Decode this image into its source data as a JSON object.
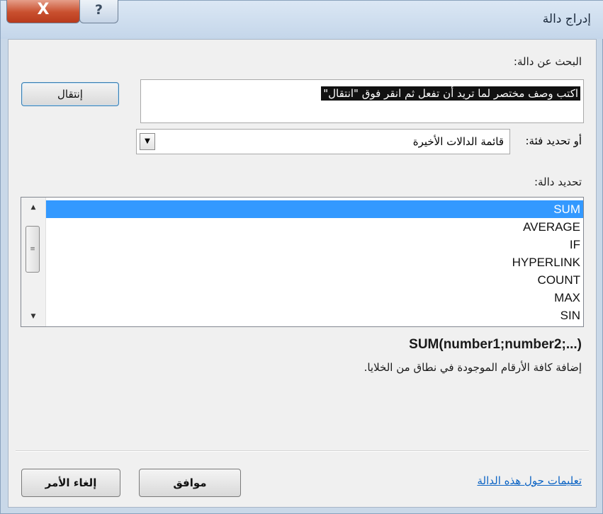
{
  "window": {
    "title": "إدراج دالة",
    "close_glyph": "X",
    "help_glyph": "?"
  },
  "search": {
    "label": "البحث عن دالة:",
    "text": "اكتب وصف مختصر لما تريد أن تفعل ثم انقر فوق \"انتقال\"",
    "go_label": "إنتقال"
  },
  "category": {
    "label": "أو تحديد فئة:",
    "selected": "قائمة الدالات الأخيرة"
  },
  "function_list": {
    "label": "تحديد دالة:",
    "items": [
      "SUM",
      "AVERAGE",
      "IF",
      "HYPERLINK",
      "COUNT",
      "MAX",
      "SIN"
    ],
    "selected": "SUM"
  },
  "details": {
    "syntax": "SUM(number1;number2;...)",
    "description": "إضافة كافة الأرقام الموجودة في نطاق من الخلايا."
  },
  "footer": {
    "help_link": "تعليمات حول هذه الدالة",
    "ok_label": "موافق",
    "cancel_label": "إلغاء الأمر"
  },
  "colors": {
    "selection": "#3399ff",
    "link": "#0b63c4",
    "close_button": "#c9502f"
  }
}
